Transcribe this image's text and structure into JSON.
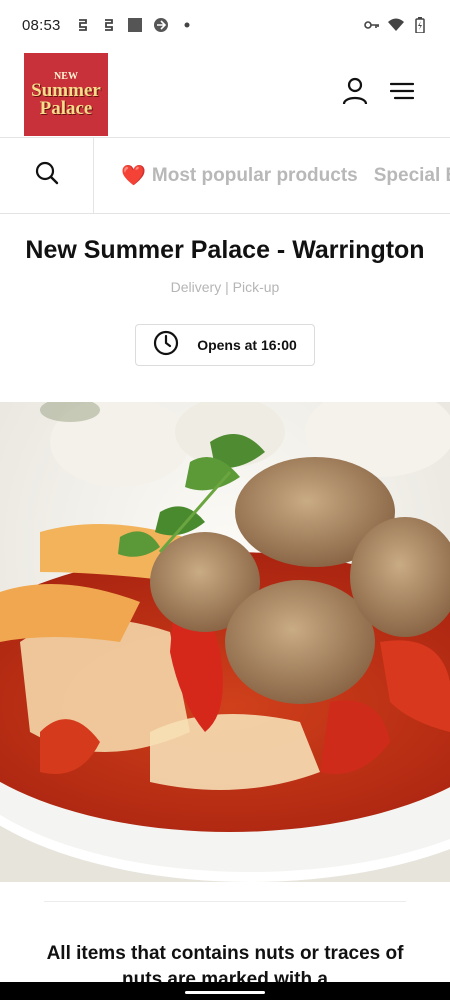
{
  "status_bar": {
    "time": "08:53",
    "icons": [
      "sync-icon",
      "sync-icon",
      "square-app-icon",
      "browser-icon",
      "dot-icon"
    ],
    "right_icons": [
      "key-icon",
      "wifi-icon",
      "battery-icon"
    ]
  },
  "header": {
    "logo": {
      "line1": "NEW",
      "line2": "Summer",
      "line3": "Palace",
      "color": "#c8313a"
    },
    "account_icon": "user-icon",
    "menu_icon": "hamburger-menu-icon"
  },
  "category_bar": {
    "search_icon": "search-icon",
    "tabs": [
      {
        "emoji": "❤️",
        "label": "Most popular products"
      },
      {
        "label": "Special Ba"
      }
    ]
  },
  "restaurant": {
    "title": "New Summer Palace - Warrington",
    "subtitle": "Delivery | Pick-up",
    "hours_label": "Opens at 16:00",
    "hours_icon": "clock-icon"
  },
  "hero": {
    "alt_icon": "food-photo"
  },
  "notice": {
    "text": "All items that contains nuts or traces of nuts are marked with a"
  },
  "colors": {
    "brand_red": "#c8313a",
    "muted_text": "#b5b5b5",
    "heart": "#e0352b"
  }
}
